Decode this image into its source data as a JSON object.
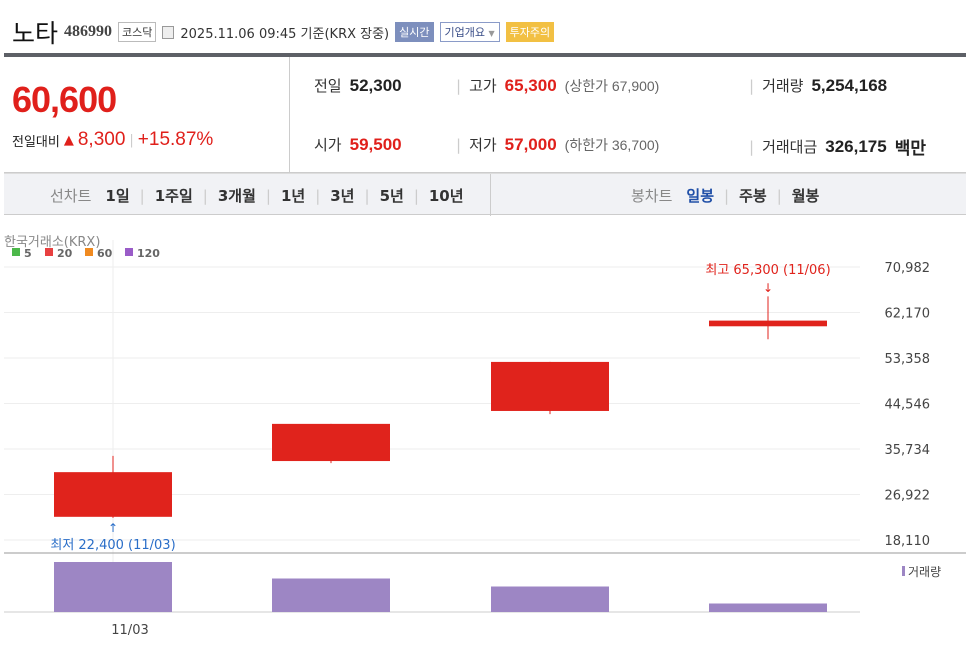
{
  "header": {
    "name": "노타",
    "code": "486990",
    "market": "코스닥",
    "datetime": "2025.11.06 09:45 기준(KRX 장중)",
    "realtime": "실시간",
    "company": "기업개요",
    "warning": "투자주의"
  },
  "quote": {
    "price": "60,600",
    "change_label": "전일대비",
    "change": "8,300",
    "change_pct": "+15.87%",
    "prev_label": "전일",
    "prev": "52,300",
    "open_label": "시가",
    "open": "59,500",
    "high_label": "고가",
    "high": "65,300",
    "upper_limit": "(상한가 67,900)",
    "low_label": "저가",
    "low": "57,000",
    "lower_limit": "(하한가 36,700)",
    "vol_label": "거래량",
    "vol": "5,254,168",
    "amt_label": "거래대금",
    "amt": "326,175",
    "amt_unit": "백만"
  },
  "tabs": {
    "line_label": "선차트",
    "line": [
      "1일",
      "1주일",
      "3개월",
      "1년",
      "3년",
      "5년",
      "10년"
    ],
    "candle_label": "봉차트",
    "candle": [
      "일봉",
      "주봉",
      "월봉"
    ]
  },
  "chart_data": {
    "type": "candlestick",
    "source": "한국거래소(KRX)",
    "legend": [
      {
        "name": "5",
        "color": "#4cb84a"
      },
      {
        "name": "20",
        "color": "#e84040"
      },
      {
        "name": "60",
        "color": "#f08a20"
      },
      {
        "name": "120",
        "color": "#9a5cc8"
      }
    ],
    "yticks": [
      "70,982",
      "62,170",
      "53,358",
      "44,546",
      "35,734",
      "26,922",
      "18,110"
    ],
    "ylim": [
      18110,
      70982
    ],
    "xtick": "11/03",
    "candles": [
      {
        "open": 22600,
        "close": 31250,
        "high": 34400,
        "low": 22400
      },
      {
        "open": 33400,
        "close": 40600,
        "high": 40600,
        "low": 33000
      },
      {
        "open": 43100,
        "close": 52600,
        "high": 52600,
        "low": 42500
      },
      {
        "open": 59500,
        "close": 60600,
        "high": 65300,
        "low": 57000
      }
    ],
    "volumes": [
      100,
      67,
      51,
      17
    ],
    "volume_label": "거래량",
    "max_label": "최고 65,300 (11/06)",
    "min_label": "최저 22,400 (11/03)"
  }
}
